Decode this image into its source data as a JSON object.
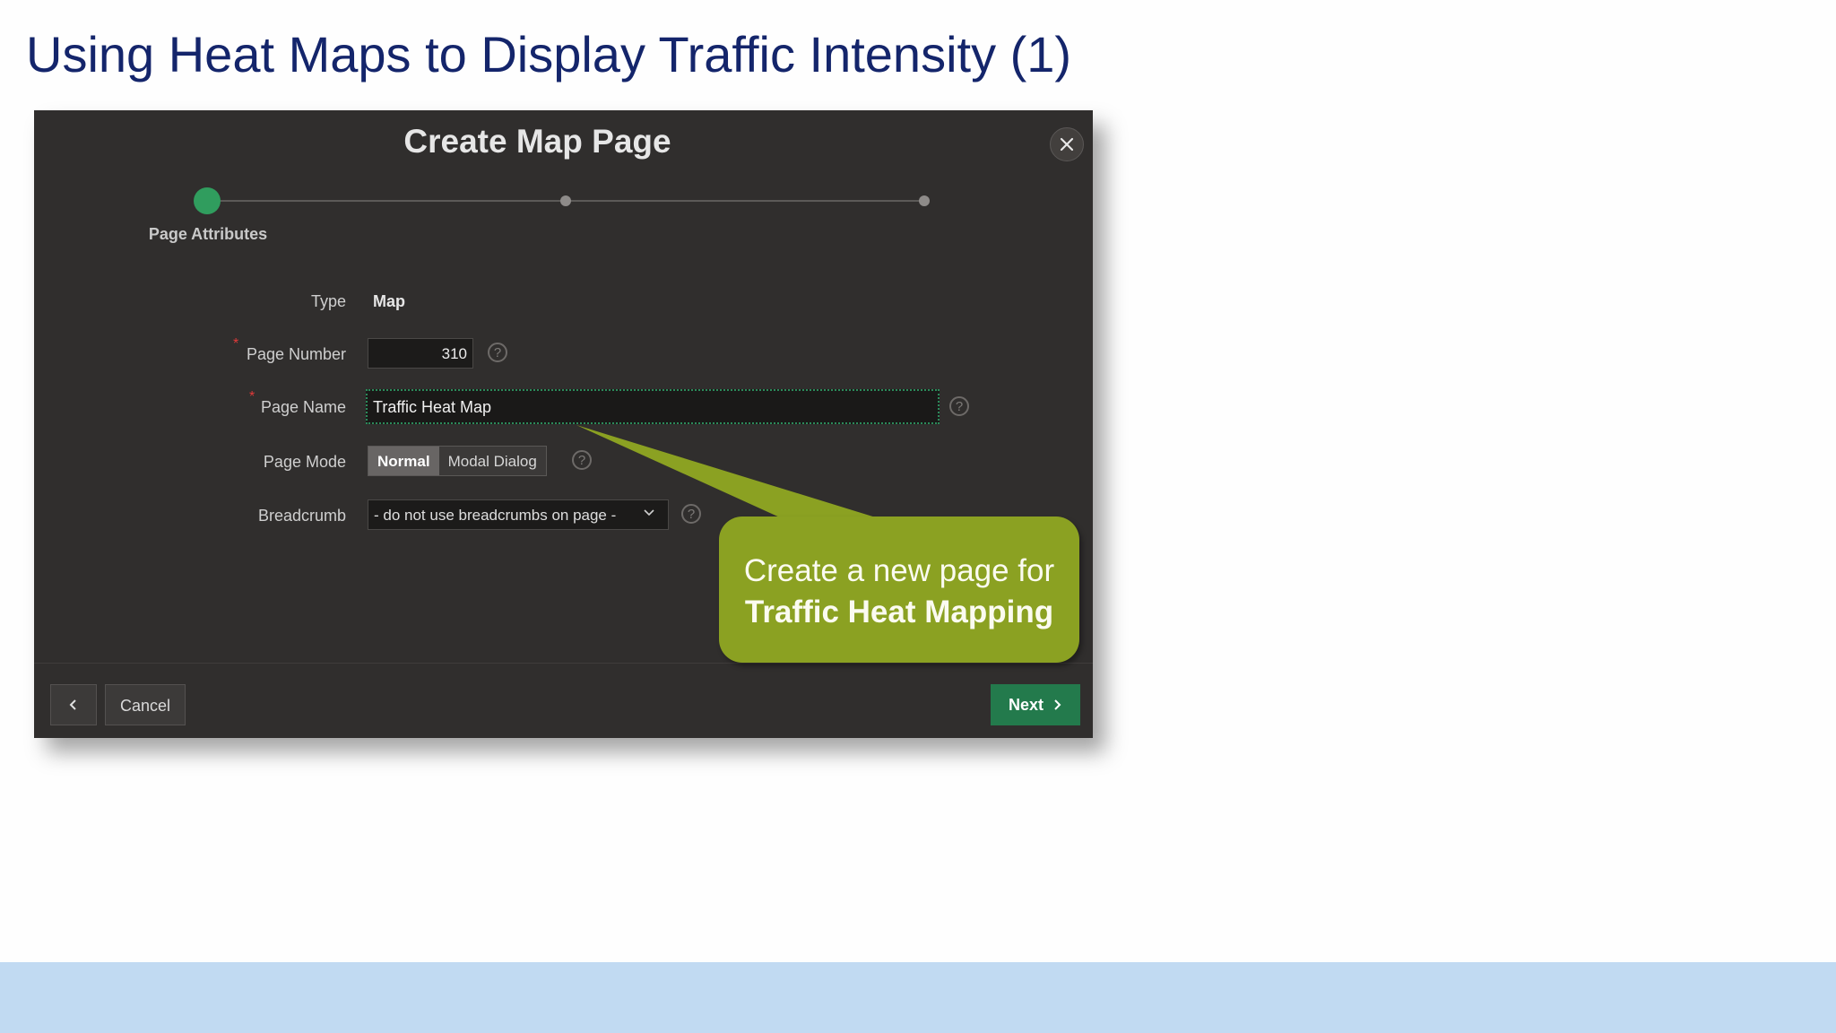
{
  "slide": {
    "title": "Using Heat Maps to Display Traffic Intensity (1)"
  },
  "dialog": {
    "title": "Create Map Page",
    "close_icon": "close-icon",
    "steps": [
      {
        "label": "Page Attributes",
        "active": true
      },
      {
        "label": "",
        "active": false
      },
      {
        "label": "",
        "active": false
      }
    ],
    "form": {
      "type_label": "Type",
      "type_value": "Map",
      "page_number_label": "Page Number",
      "page_number_value": "310",
      "page_name_label": "Page Name",
      "page_name_value": "Traffic Heat Map",
      "page_mode_label": "Page Mode",
      "page_mode_options": [
        "Normal",
        "Modal Dialog"
      ],
      "page_mode_selected": "Normal",
      "breadcrumb_label": "Breadcrumb",
      "breadcrumb_value": "- do not use breadcrumbs on page -",
      "required_marker": "*",
      "help_glyph": "?"
    },
    "footer": {
      "back_icon": "chevron-left-icon",
      "cancel_label": "Cancel",
      "next_label": "Next",
      "next_icon": "chevron-right-icon"
    }
  },
  "callout": {
    "line1": "Create a new page for",
    "line2": "Traffic Heat Mapping"
  },
  "colors": {
    "title": "#14256b",
    "dialog_bg": "#302e2d",
    "accent_green": "#309d5e",
    "next_button": "#237a4c",
    "callout": "#8ba122",
    "footer_band": "#c1daf2"
  }
}
